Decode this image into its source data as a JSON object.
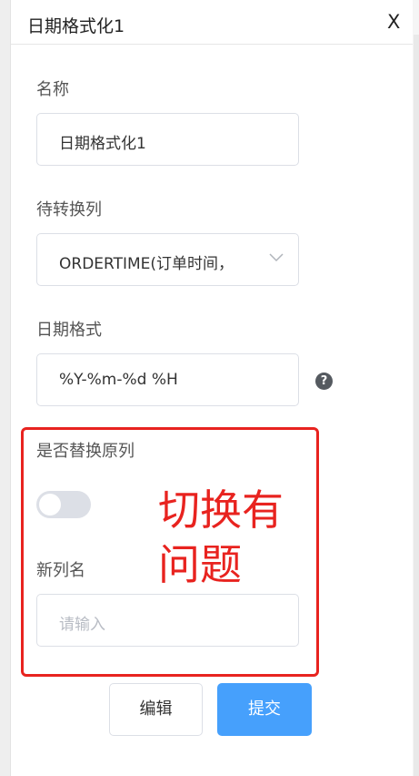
{
  "header": {
    "title": "日期格式化1",
    "close_label": "X"
  },
  "form": {
    "name_label": "名称",
    "name_value": "日期格式化1",
    "column_label": "待转换列",
    "column_value": "ORDERTIME(订单时间，",
    "format_label": "日期格式",
    "format_value": "%Y-%m-%d %H",
    "help_icon": "?",
    "replace_label": "是否替换原列",
    "replace_enabled": false,
    "new_column_label": "新列名",
    "new_column_placeholder": "请输入"
  },
  "annotation": {
    "line1": "切换有",
    "line2": "问题",
    "color": "#e8231f"
  },
  "buttons": {
    "edit_label": "编辑",
    "submit_label": "提交",
    "submit_color": "#46a0fc"
  }
}
